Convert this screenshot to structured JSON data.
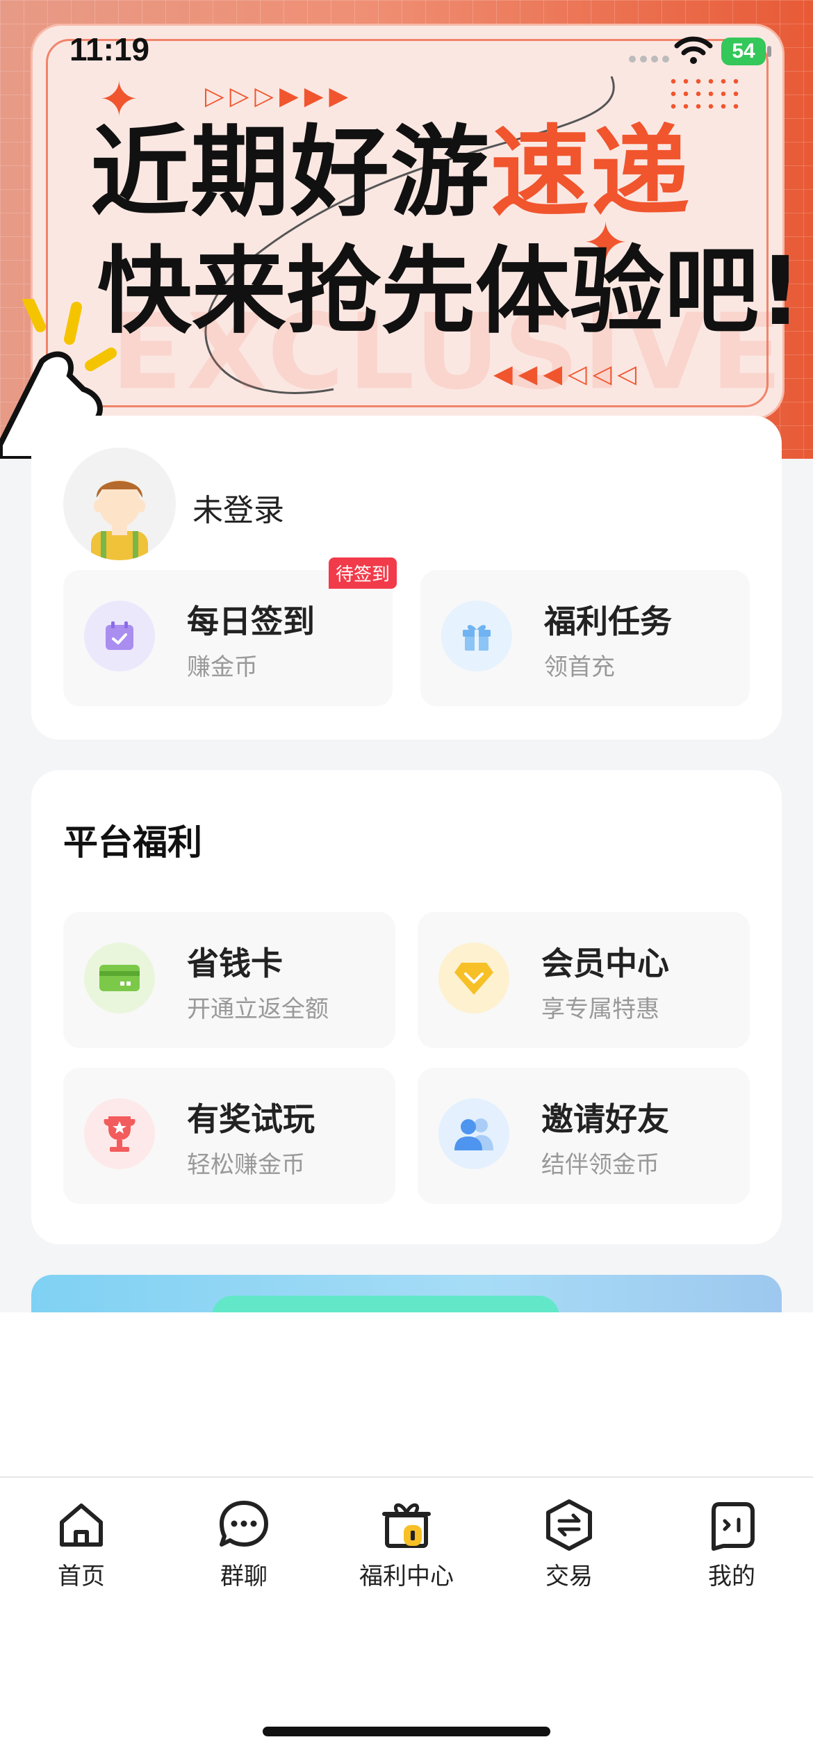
{
  "status_bar": {
    "time": "11:19",
    "battery": "54"
  },
  "banner": {
    "title_black": "近期好游",
    "title_highlight": "速递",
    "subtitle": "快来抢先体验吧!",
    "watermark": "EXCLUSIVE",
    "highlight_color": "#f0552e"
  },
  "user": {
    "login_status": "未登录",
    "checkin": {
      "title": "每日签到",
      "subtitle": "赚金币",
      "badge": "待签到",
      "icon": "calendar-check-icon"
    },
    "tasks": {
      "title": "福利任务",
      "subtitle": "领首充",
      "icon": "gift-icon"
    }
  },
  "platform_benefits": {
    "title": "平台福利",
    "items": [
      {
        "title": "省钱卡",
        "subtitle": "开通立返全额",
        "icon": "card-icon"
      },
      {
        "title": "会员中心",
        "subtitle": "享专属特惠",
        "icon": "diamond-icon"
      },
      {
        "title": "有奖试玩",
        "subtitle": "轻松赚金币",
        "icon": "trophy-icon"
      },
      {
        "title": "邀请好友",
        "subtitle": "结伴领金币",
        "icon": "friends-icon"
      }
    ]
  },
  "tab_bar": {
    "tabs": [
      {
        "label": "首页",
        "icon": "home-icon"
      },
      {
        "label": "群聊",
        "icon": "chat-icon"
      },
      {
        "label": "福利中心",
        "icon": "gift-box-icon"
      },
      {
        "label": "交易",
        "icon": "exchange-icon"
      },
      {
        "label": "我的",
        "icon": "profile-icon"
      }
    ]
  }
}
